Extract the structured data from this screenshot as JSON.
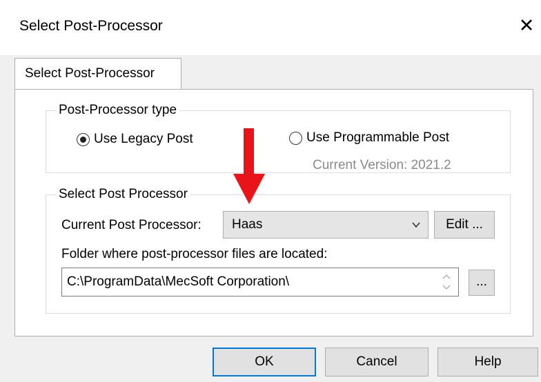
{
  "window": {
    "title": "Select Post-Processor",
    "close_glyph": "✕"
  },
  "tab": {
    "label": "Select Post-Processor"
  },
  "post_type_group": {
    "label": "Post-Processor type",
    "legacy_label": "Use Legacy Post",
    "legacy_selected": true,
    "programmable_label": "Use Programmable Post",
    "programmable_selected": false,
    "current_version": "Current Version: 2021.2"
  },
  "select_group": {
    "label": "Select Post Processor",
    "current_label": "Current Post Processor:",
    "current_value": "Haas",
    "edit_label": "Edit ...",
    "folder_label": "Folder where post-processor files are located:",
    "folder_value": "C:\\ProgramData\\MecSoft Corporation\\",
    "browse_label": "..."
  },
  "buttons": {
    "ok": "OK",
    "cancel": "Cancel",
    "help": "Help"
  },
  "colors": {
    "annotation_arrow": "#e8141a",
    "default_button_border": "#0078d7"
  },
  "icons": [
    "close-icon",
    "chevron-down-icon",
    "spin-up-icon",
    "spin-down-icon",
    "red-arrow-annotation"
  ]
}
